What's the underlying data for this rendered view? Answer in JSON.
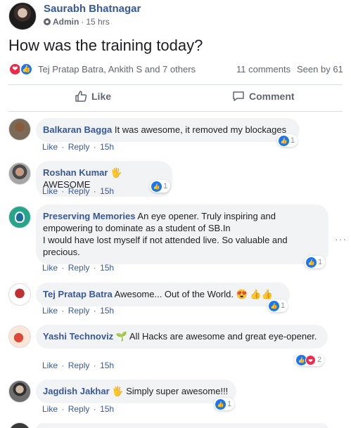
{
  "post": {
    "author": "Saurabh Bhatnagar",
    "role": "Admin",
    "time": "15 hrs",
    "meta_sep": "·",
    "text": "How was the training today?",
    "reactors": "Tej Pratap Batra, Ankith S and 7 others",
    "comments_count": "11 comments",
    "seen_by": "Seen by 61",
    "like_label": "Like",
    "comment_label": "Comment"
  },
  "comment_actions": {
    "like": "Like",
    "reply": "Reply",
    "sep": "·"
  },
  "comments": [
    {
      "name": "Balkaran Bagga",
      "text": " It was awesome, it removed my blockages",
      "time": "15h",
      "reactions": "1"
    },
    {
      "name": "Roshan Kumar",
      "text": " 🖐 AWESOME",
      "time": "15h",
      "reactions": "1"
    },
    {
      "name": "Preserving Memories",
      "text": " An eye opener. Truly inspiring and empowering to dominate as a student of SB.In\nI would have lost myself if not attended live. So valuable and precious.",
      "time": "15h",
      "reactions": "1"
    },
    {
      "name": "Tej Pratap Batra",
      "text": " Awesome... Out of the World. 😍 👍👍",
      "time": "15h",
      "reactions": "1"
    },
    {
      "name": "Yashi Technoviz",
      "text": " 🌱 All Hacks are awesome and great eye-opener.",
      "time": "15h",
      "reactions": "2"
    },
    {
      "name": "Jagdish Jakhar",
      "text": " 🖐 Simply super awesome!!!",
      "time": "15h",
      "reactions": "1"
    }
  ],
  "more_icon": "···",
  "colors": {
    "link": "#385898",
    "like_blue": "#1877f2",
    "love_red": "#f0284a",
    "bubble": "#f2f3f5"
  }
}
